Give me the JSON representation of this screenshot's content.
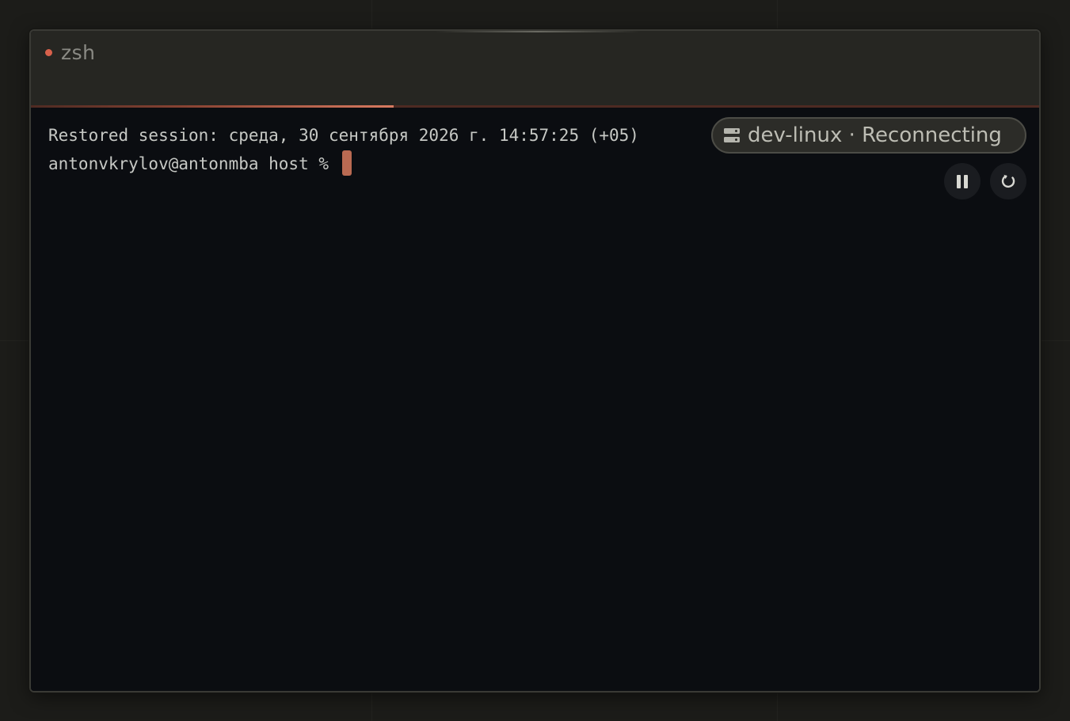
{
  "window": {
    "tab_title": "zsh",
    "status_dot_color": "#d8614b"
  },
  "progress": {
    "fraction": 0.36,
    "color": "#d87a60"
  },
  "terminal": {
    "lines": [
      "Restored session: среда, 30 сентября 2026 г. 14:57:25 (+05)",
      "antonvkrylov@antonmba host % "
    ],
    "cursor_color": "#b96a52"
  },
  "connection": {
    "icon": "server-icon",
    "label": "dev-linux · Reconnecting"
  },
  "controls": {
    "pause_icon": "pause-icon",
    "reload_icon": "reload-icon"
  }
}
